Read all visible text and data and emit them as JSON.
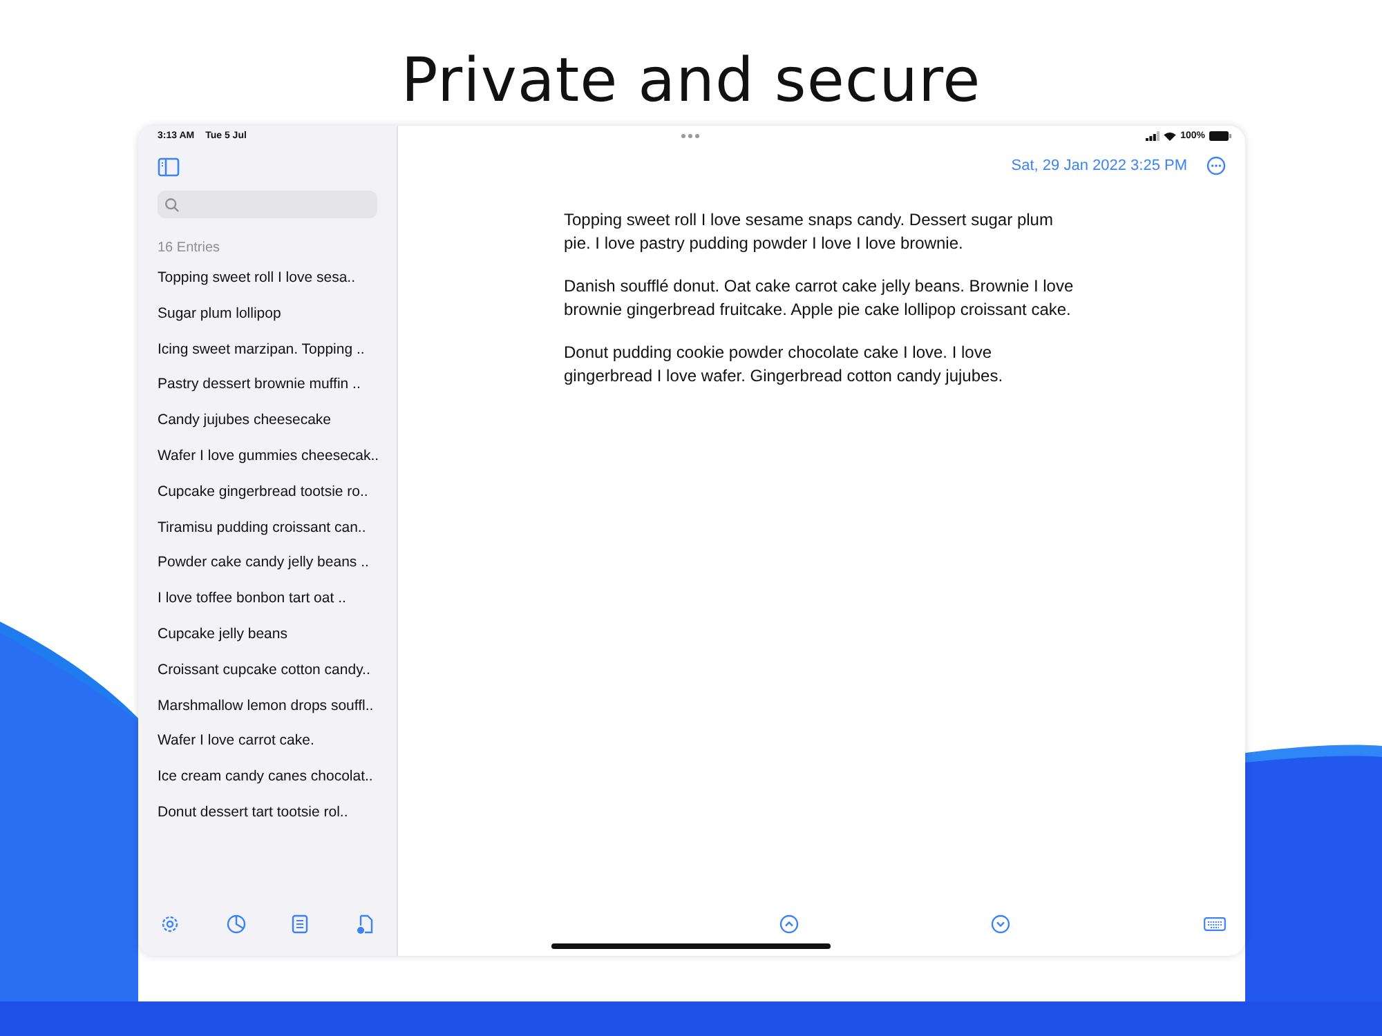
{
  "headline": "Private and secure",
  "status_bar": {
    "time": "3:13 AM",
    "date": "Tue 5 Jul",
    "battery": "100%"
  },
  "sidebar": {
    "entries_count": "16 Entries",
    "entries": [
      "Topping sweet roll I love sesa..",
      "Sugar plum lollipop",
      "Icing sweet marzipan. Topping ..",
      "Pastry dessert brownie muffin ..",
      "Candy jujubes cheesecake",
      "Wafer I love gummies cheesecak..",
      "Cupcake gingerbread tootsie ro..",
      "Tiramisu pudding croissant can..",
      "Powder cake candy jelly beans ..",
      "I love toffee bonbon tart oat ..",
      "Cupcake jelly beans",
      "Croissant cupcake cotton candy..",
      "Marshmallow lemon drops souffl..",
      "Wafer I love carrot cake.",
      "Ice cream candy canes chocolat..",
      "Donut dessert tart tootsie rol.."
    ]
  },
  "editor": {
    "date": "Sat, 29 Jan 2022 3:25 PM",
    "paragraphs": [
      "Topping sweet roll I love sesame snaps candy. Dessert sugar plum pie. I love pastry pudding powder I love I love brownie.",
      "Danish soufflé donut. Oat cake carrot cake jelly beans. Brownie I love brownie gingerbread fruitcake. Apple pie cake lollipop croissant cake.",
      "Donut pudding cookie powder chocolate cake I love. I love gingerbread I love wafer. Gingerbread cotton candy jujubes."
    ]
  }
}
